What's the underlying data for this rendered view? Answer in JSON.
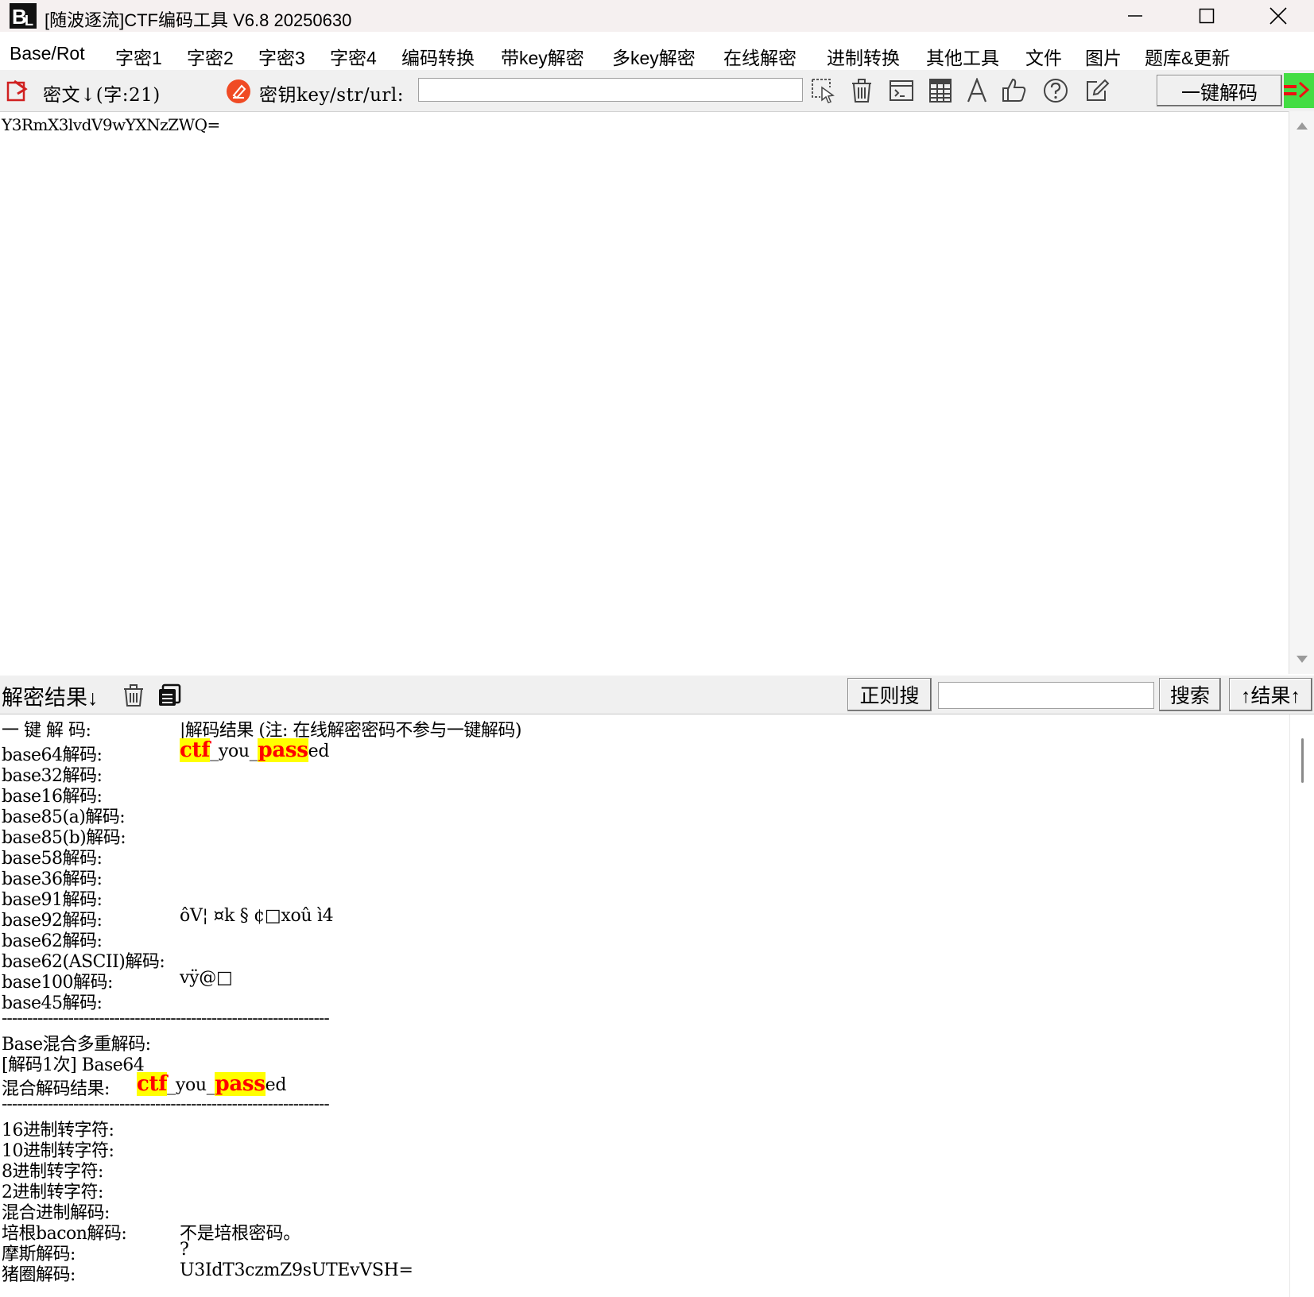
{
  "window": {
    "title": "[随波逐流]CTF编码工具 V6.8  20250630",
    "minimize_icon": "minimize-icon",
    "maximize_icon": "maximize-icon",
    "close_icon": "close-icon"
  },
  "menu": {
    "items": [
      "Base/Rot",
      "字密1",
      "字密2",
      "字密3",
      "字密4",
      "编码转换",
      "带key解密",
      "多key解密",
      "在线解密",
      "进制转换",
      "其他工具",
      "文件",
      "图片",
      "题库&更新"
    ]
  },
  "toolbar": {
    "cipher_label": "密文↓(字:21)",
    "key_label": "密钥key/str/url:",
    "key_value": "",
    "decode_button": "一键解码",
    "icons": [
      "import-icon",
      "eraser-icon",
      "select-cursor-icon",
      "trash-icon",
      "terminal-icon",
      "table-icon",
      "font-icon",
      "thumbs-up-icon",
      "help-icon",
      "edit-icon"
    ],
    "accent_color": "#44dd44"
  },
  "cipher": {
    "text": "Y3RmX3lvdV9wYXNzZWQ="
  },
  "result_bar": {
    "label": "解密结果↓",
    "regex_button": "正则搜",
    "search_value": "",
    "search_button": "搜索",
    "result_up_button": "↑结果↑"
  },
  "results": {
    "header_left": "一 键 解 码:",
    "header_right": "|解码结果 (注: 在线解密密码不参与一键解码)",
    "base64_label": "base64解码:",
    "base64_hl1": "ctf",
    "base64_mid": "_you_",
    "base64_hl2": "pass",
    "base64_tail": "ed",
    "lines_a": [
      {
        "label": "base32解码:",
        "value": ""
      },
      {
        "label": "base16解码:",
        "value": ""
      },
      {
        "label": "base85(a)解码:",
        "value": ""
      },
      {
        "label": "base85(b)解码:",
        "value": ""
      },
      {
        "label": "base58解码:",
        "value": ""
      },
      {
        "label": "base36解码:",
        "value": ""
      },
      {
        "label": "base91解码:",
        "value": ""
      },
      {
        "label": "base92解码:",
        "value": "ôV¦ ¤k § ¢□xoû   ì4"
      },
      {
        "label": "base62解码:",
        "value": ""
      },
      {
        "label": "base62(ASCII)解码:",
        "value": ""
      },
      {
        "label": "base100解码:",
        "value": "vÿ@□"
      },
      {
        "label": "base45解码:",
        "value": ""
      }
    ],
    "separator": "----------------------------------------------------------------",
    "mixed_title": "Base混合多重解码:",
    "mixed_step": "[解码1次] Base64",
    "mixed_result_label": "混合解码结果:",
    "lines_b": [
      {
        "label": "16进制转字符:",
        "value": ""
      },
      {
        "label": "10进制转字符:",
        "value": ""
      },
      {
        "label": "8进制转字符:",
        "value": ""
      },
      {
        "label": "2进制转字符:",
        "value": ""
      },
      {
        "label": "混合进制解码:",
        "value": ""
      },
      {
        "label": "培根bacon解码:",
        "value": "不是培根密码。"
      },
      {
        "label": "摩斯解码:",
        "value": "?"
      },
      {
        "label": "猪圈解码:",
        "value": "U3IdT3czmZ9sUTEvVSH="
      }
    ],
    "highlight_colors": {
      "bg": "#ffff00",
      "fg": "#ff0000"
    }
  }
}
